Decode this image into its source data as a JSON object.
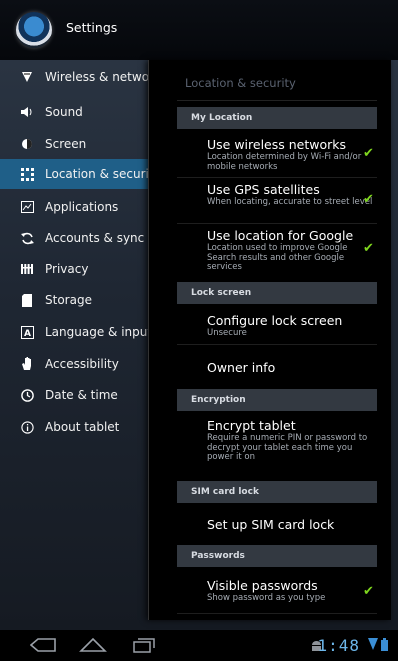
{
  "header": {
    "title": "Settings"
  },
  "sidebar": {
    "items": [
      {
        "label": "Wireless & networks",
        "icon": "wifi-icon"
      },
      {
        "label": "Sound",
        "icon": "speaker-icon"
      },
      {
        "label": "Screen",
        "icon": "brightness-icon"
      },
      {
        "label": "Location & security",
        "icon": "location-grid-icon",
        "active": true
      },
      {
        "label": "Applications",
        "icon": "applications-icon"
      },
      {
        "label": "Accounts & sync",
        "icon": "sync-icon"
      },
      {
        "label": "Privacy",
        "icon": "privacy-icon"
      },
      {
        "label": "Storage",
        "icon": "storage-icon"
      },
      {
        "label": "Language & input",
        "icon": "language-icon"
      },
      {
        "label": "Accessibility",
        "icon": "hand-icon"
      },
      {
        "label": "Date & time",
        "icon": "clock-icon"
      },
      {
        "label": "About tablet",
        "icon": "info-icon"
      }
    ]
  },
  "panel": {
    "title": "Location & security",
    "categories": {
      "my_location": "My Location",
      "lock_screen": "Lock screen",
      "encryption": "Encryption",
      "sim_card_lock": "SIM card lock",
      "passwords": "Passwords"
    },
    "prefs": {
      "wireless": {
        "title": "Use wireless networks",
        "summary": "Location determined by Wi-Fi and/or mobile networks",
        "checked": true
      },
      "gps": {
        "title": "Use GPS satellites",
        "summary": "When locating, accurate to street level",
        "checked": true
      },
      "google": {
        "title": "Use location for Google",
        "summary": "Location used to improve Google Search results and other Google services",
        "checked": true
      },
      "configure_lock": {
        "title": "Configure lock screen",
        "summary": "Unsecure"
      },
      "owner_info": {
        "title": "Owner info"
      },
      "encrypt": {
        "title": "Encrypt tablet",
        "summary": "Require a numeric PIN or password to decrypt your tablet each time you power it on"
      },
      "sim_lock": {
        "title": "Set up SIM card lock"
      },
      "visible_passwords": {
        "title": "Visible passwords",
        "summary": "Show password as you type",
        "checked": true
      }
    }
  },
  "status_bar": {
    "time": "1:48"
  },
  "colors": {
    "accent": "#1f5f88",
    "check": "#7fd61e",
    "clock": "#6db7ea"
  }
}
